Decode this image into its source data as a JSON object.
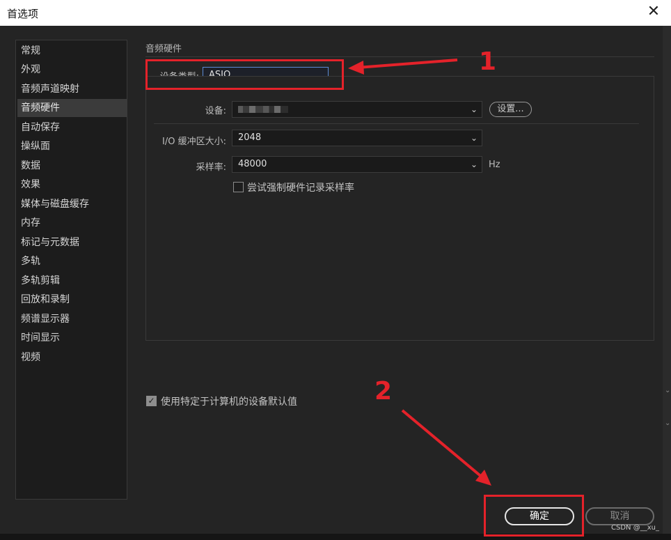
{
  "window": {
    "title": "首选项",
    "close_symbol": "✕"
  },
  "sidebar": {
    "items": [
      {
        "label": "常规",
        "active": false
      },
      {
        "label": "外观",
        "active": false
      },
      {
        "label": "音频声道映射",
        "active": false
      },
      {
        "label": "音频硬件",
        "active": true
      },
      {
        "label": "自动保存",
        "active": false
      },
      {
        "label": "操纵面",
        "active": false
      },
      {
        "label": "数据",
        "active": false
      },
      {
        "label": "效果",
        "active": false
      },
      {
        "label": "媒体与磁盘缓存",
        "active": false
      },
      {
        "label": "内存",
        "active": false
      },
      {
        "label": "标记与元数据",
        "active": false
      },
      {
        "label": "多轨",
        "active": false
      },
      {
        "label": "多轨剪辑",
        "active": false
      },
      {
        "label": "回放和录制",
        "active": false
      },
      {
        "label": "频谱显示器",
        "active": false
      },
      {
        "label": "时间显示",
        "active": false
      },
      {
        "label": "视频",
        "active": false
      }
    ]
  },
  "audio_hardware": {
    "section_title": "音频硬件",
    "device_type": {
      "label": "设备类型:",
      "value": "ASIO"
    },
    "device": {
      "label": "设备:",
      "value": "",
      "settings_button": "设置..."
    },
    "io_buffer": {
      "label": "I/O 缓冲区大小:",
      "value": "2048"
    },
    "sample_rate": {
      "label": "采样率:",
      "value": "48000",
      "unit": "Hz"
    },
    "force_sample_rate": {
      "label": "尝试强制硬件记录采样率",
      "checked": false
    }
  },
  "use_machine_defaults": {
    "label": "使用特定于计算机的设备默认值",
    "checked": true
  },
  "buttons": {
    "ok": "确定",
    "cancel": "取消"
  },
  "annotations": {
    "marker_1": "1",
    "marker_2": "2",
    "color": "#e4222a"
  },
  "watermark": "CSDN @__xu_"
}
